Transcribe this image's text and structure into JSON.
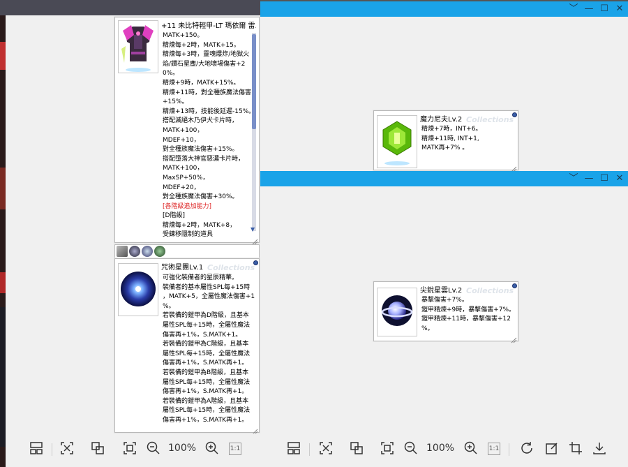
{
  "viewer": {
    "zoom_left": "100%",
    "zoom_right": "100%",
    "actual_size_label": "1:1"
  },
  "armor": {
    "title": "+11 未比特輕甲-LT 瑪依爾 雷...",
    "lines": [
      "MATK+150。",
      "精煉每+2時，MATK+15。",
      "精煉每+3時，靈魂爆炸/地獄火",
      "焰/鑽石星塵/大地壞場傷害+2",
      "0%。",
      "精煉+9時，MATK+15%。",
      "精煉+11時，對全種族魔法傷害",
      "+15%。",
      "精煉+13時，技能後延遲-15%。",
      "搭配滅絕木乃伊犬卡片時，",
      "MATK+100，",
      "MDEF+10，",
      "對全種族魔法傷害+15%。",
      "搭配墮落大神官惡濃卡片時，",
      "MATK+100，",
      "MaxSP+50%，",
      "MDEF+20，",
      "對全種族魔法傷害+30%。",
      "[各階級追加能力]",
      "[D階級]",
      "精煉每+2時，MATK+8，",
      "受鍊移隱制的道具"
    ],
    "red_line": "[各階級追加能力]"
  },
  "star_circle": {
    "title": "咒術星團Lv.1",
    "watermark": "Collections",
    "lines": [
      "可強化裝備者的星辰精華。",
      "裝備者的基本屬性SPL每+15時",
      "，MATK+5，全屬性魔法傷害+1",
      "%。",
      "若裝備的鎧甲為D階級，且基本",
      "屬性SPL每+15時，全屬性魔法",
      "傷害再+1%，S.MATK+1。",
      "若裝備的鎧甲為C階級，且基本",
      "屬性SPL每+15時，全屬性魔法",
      "傷害再+1%，S.MATK再+1。",
      "若裝備的鎧甲為B階級，且基本",
      "屬性SPL每+15時，全屬性魔法",
      "傷害再+1%，S.MATK再+1。",
      "若裝備的鎧甲為A階級，且基本",
      "屬性SPL每+15時，全屬性魔法",
      "傷害再+1%，S.MATK再+1。"
    ]
  },
  "magic_nif": {
    "title": "魔力尼夫Lv.2",
    "watermark": "Collections",
    "lines": [
      "精煉+7時，INT+6。",
      "精煉+11時, INT+1,",
      "MATK再+7% 。"
    ]
  },
  "sharp_star": {
    "title": "尖銳星雲Lv.2",
    "watermark": "Collections",
    "lines": [
      "暴擊傷害+7%。",
      "鎧甲精煉+9時，暴擊傷害+7%。",
      "鎧甲精煉+11時，暴擊傷害+12",
      "%。"
    ]
  },
  "colors": {
    "titlebar": "#1aa3e8",
    "red_text": "#dd2222"
  }
}
